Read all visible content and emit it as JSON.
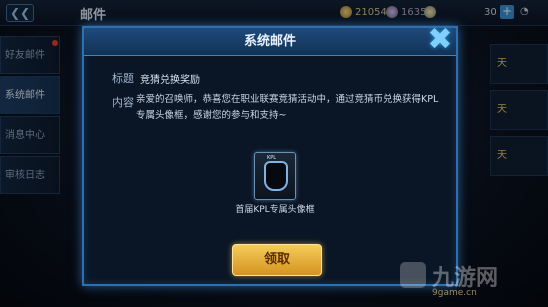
{
  "top_bar": {
    "back_label": "❮❮",
    "title": "邮件",
    "gold": "21054",
    "gems": "1635",
    "level": "30",
    "plus_label": "+"
  },
  "side_nav": {
    "items": [
      {
        "label": "好友邮件"
      },
      {
        "label": "系统邮件"
      },
      {
        "label": "消息中心"
      },
      {
        "label": "审核日志"
      }
    ]
  },
  "right_rows": [
    "天",
    "天",
    "天"
  ],
  "modal": {
    "title": "系统邮件",
    "subject_label": "标题",
    "subject_value": "竞猜兑换奖励",
    "content_label": "内容",
    "content_text": "亲爱的召唤师，恭喜您在职业联赛竞猜活动中，通过竞猜币兑换获得KPL专属头像框，感谢您的参与和支持~",
    "reward_tag": "KPL",
    "reward_caption": "首届KPL专属头像框",
    "claim_label": "领取",
    "close_label": "✖"
  },
  "watermark": {
    "text": "九游网",
    "url": "9game.cn"
  }
}
